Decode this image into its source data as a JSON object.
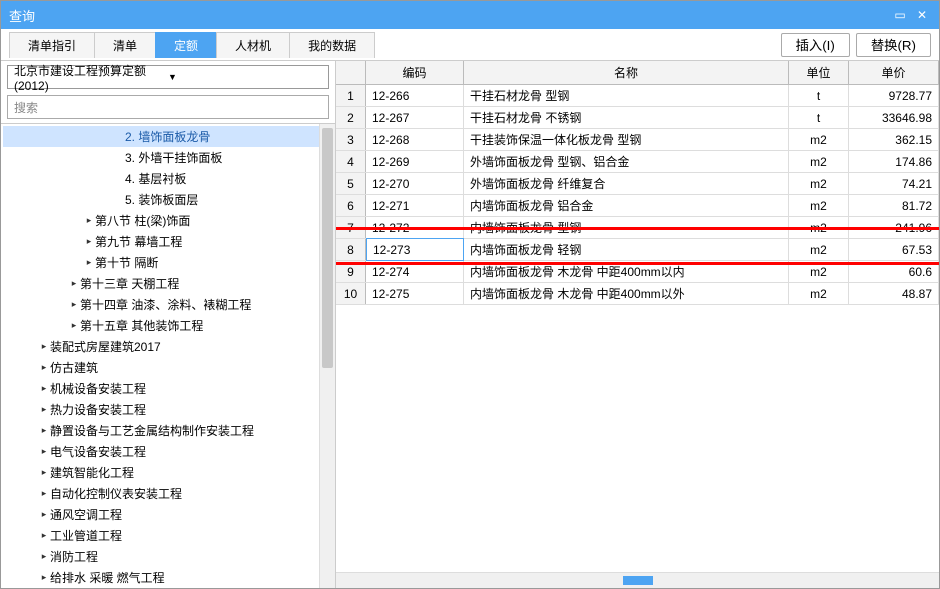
{
  "window": {
    "title": "查询"
  },
  "toolbar": {
    "tabs": [
      "清单指引",
      "清单",
      "定额",
      "人材机",
      "我的数据"
    ],
    "active_tab": 2,
    "insert_btn": "插入(I)",
    "replace_btn": "替换(R)"
  },
  "sidebar": {
    "combo": "北京市建设工程预算定额(2012)",
    "search_placeholder": "搜索",
    "tree": [
      {
        "indent": 110,
        "exp": "",
        "label": "2.  墙饰面板龙骨",
        "sel": true
      },
      {
        "indent": 110,
        "exp": "",
        "label": "3.  外墙干挂饰面板"
      },
      {
        "indent": 110,
        "exp": "",
        "label": "4.  基层衬板"
      },
      {
        "indent": 110,
        "exp": "",
        "label": "5.  装饰板面层"
      },
      {
        "indent": 80,
        "exp": "▸",
        "label": "第八节 柱(梁)饰面"
      },
      {
        "indent": 80,
        "exp": "▸",
        "label": "第九节 幕墙工程"
      },
      {
        "indent": 80,
        "exp": "▸",
        "label": "第十节 隔断"
      },
      {
        "indent": 65,
        "exp": "▸",
        "label": "第十三章 天棚工程"
      },
      {
        "indent": 65,
        "exp": "▸",
        "label": "第十四章 油漆、涂料、裱糊工程"
      },
      {
        "indent": 65,
        "exp": "▸",
        "label": "第十五章 其他装饰工程"
      },
      {
        "indent": 35,
        "exp": "▸",
        "label": "装配式房屋建筑2017"
      },
      {
        "indent": 35,
        "exp": "▸",
        "label": "仿古建筑"
      },
      {
        "indent": 35,
        "exp": "▸",
        "label": "机械设备安装工程"
      },
      {
        "indent": 35,
        "exp": "▸",
        "label": "热力设备安装工程"
      },
      {
        "indent": 35,
        "exp": "▸",
        "label": "静置设备与工艺金属结构制作安装工程"
      },
      {
        "indent": 35,
        "exp": "▸",
        "label": "电气设备安装工程"
      },
      {
        "indent": 35,
        "exp": "▸",
        "label": "建筑智能化工程"
      },
      {
        "indent": 35,
        "exp": "▸",
        "label": "自动化控制仪表安装工程"
      },
      {
        "indent": 35,
        "exp": "▸",
        "label": "通风空调工程"
      },
      {
        "indent": 35,
        "exp": "▸",
        "label": "工业管道工程"
      },
      {
        "indent": 35,
        "exp": "▸",
        "label": "消防工程"
      },
      {
        "indent": 35,
        "exp": "▸",
        "label": "给排水 采暖 燃气工程"
      }
    ]
  },
  "grid": {
    "headers": {
      "code": "编码",
      "name": "名称",
      "unit": "单位",
      "price": "单价"
    },
    "rows": [
      {
        "n": "1",
        "code": "12-266",
        "name": "干挂石材龙骨  型钢",
        "unit": "t",
        "price": "9728.77"
      },
      {
        "n": "2",
        "code": "12-267",
        "name": "干挂石材龙骨  不锈钢",
        "unit": "t",
        "price": "33646.98"
      },
      {
        "n": "3",
        "code": "12-268",
        "name": "干挂装饰保温一体化板龙骨  型钢",
        "unit": "m2",
        "price": "362.15"
      },
      {
        "n": "4",
        "code": "12-269",
        "name": "外墙饰面板龙骨  型钢、铝合金",
        "unit": "m2",
        "price": "174.86"
      },
      {
        "n": "5",
        "code": "12-270",
        "name": "外墙饰面板龙骨  纤维复合",
        "unit": "m2",
        "price": "74.21"
      },
      {
        "n": "6",
        "code": "12-271",
        "name": "内墙饰面板龙骨  铝合金",
        "unit": "m2",
        "price": "81.72"
      },
      {
        "n": "7",
        "code": "12-272",
        "name": "内墙饰面板龙骨  型钢",
        "unit": "m2",
        "price": "241.96"
      },
      {
        "n": "8",
        "code": "12-273",
        "name": "内墙饰面板龙骨  轻钢",
        "unit": "m2",
        "price": "67.53",
        "editing": true
      },
      {
        "n": "9",
        "code": "12-274",
        "name": "内墙饰面板龙骨  木龙骨  中距400mm以内",
        "unit": "m2",
        "price": "60.6"
      },
      {
        "n": "10",
        "code": "12-275",
        "name": "内墙饰面板龙骨  木龙骨  中距400mm以外",
        "unit": "m2",
        "price": "48.87"
      }
    ],
    "highlight_row_index": 7
  }
}
